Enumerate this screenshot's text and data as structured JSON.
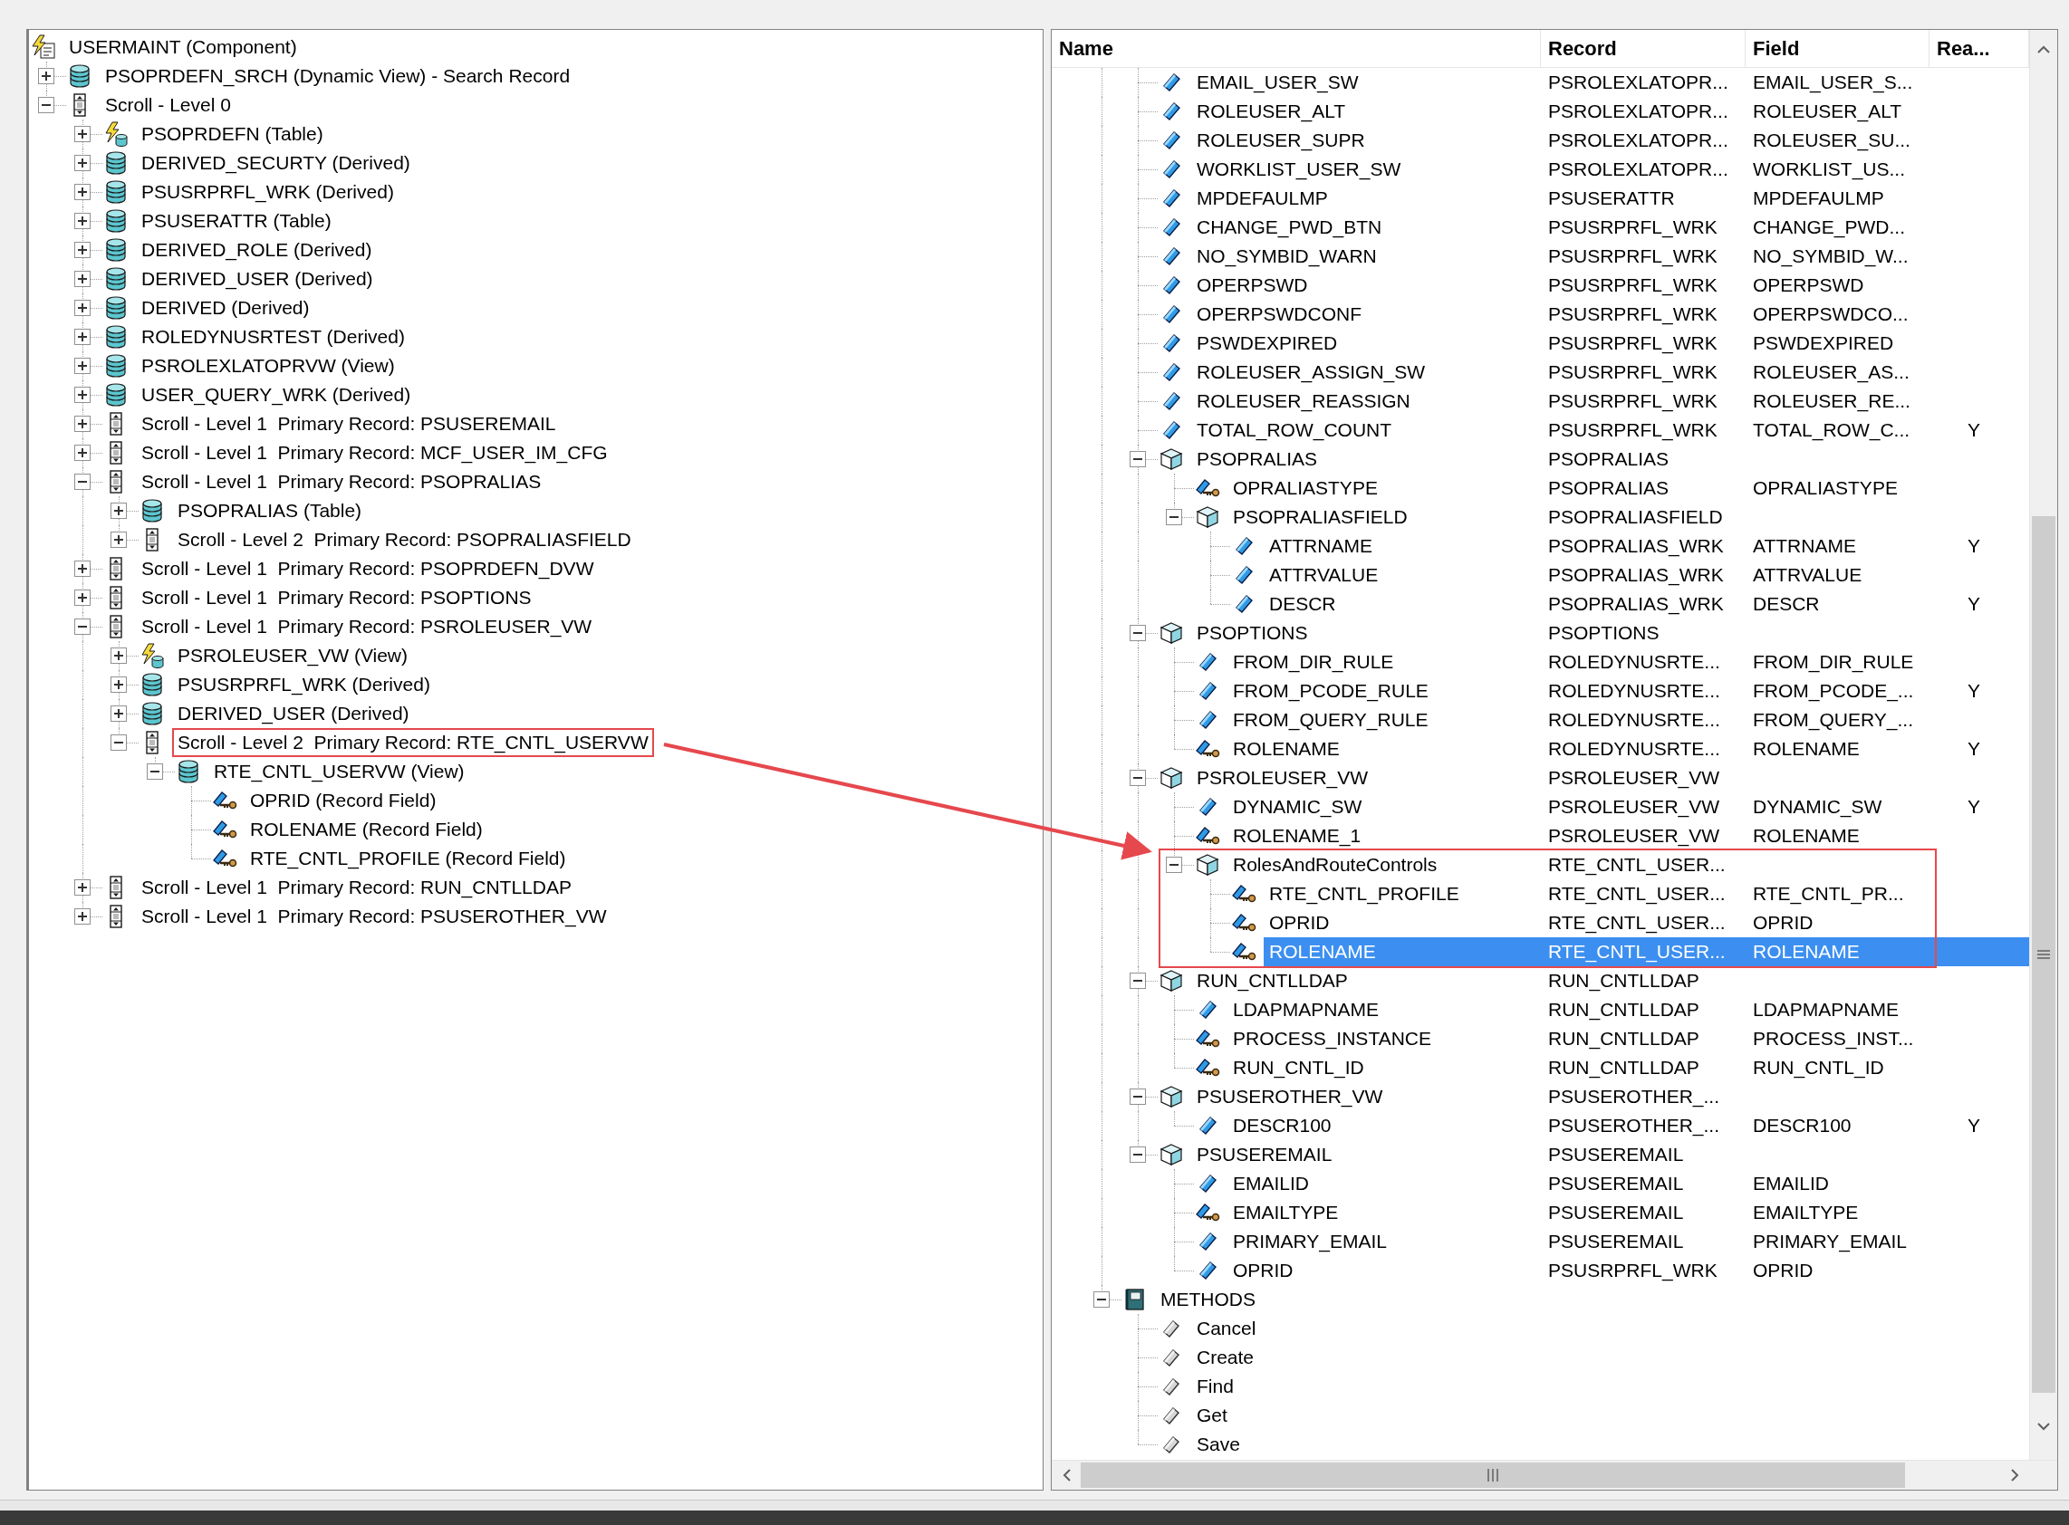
{
  "left_tree": {
    "nodes": [
      {
        "name": "USERMAINT (Component)",
        "kind": "component",
        "children": [
          {
            "name": "PSOPRDEFN_SRCH (Dynamic View) - Search Record",
            "kind": "record",
            "expanded": false
          },
          {
            "name": "Scroll - Level 0",
            "kind": "scroll",
            "expanded": true,
            "children": [
              {
                "name": "PSOPRDEFN (Table)",
                "kind": "record-event",
                "expanded": false
              },
              {
                "name": "DERIVED_SECURTY (Derived)",
                "kind": "record",
                "expanded": false
              },
              {
                "name": "PSUSRPRFL_WRK (Derived)",
                "kind": "record",
                "expanded": false
              },
              {
                "name": "PSUSERATTR (Table)",
                "kind": "record",
                "expanded": false
              },
              {
                "name": "DERIVED_ROLE (Derived)",
                "kind": "record",
                "expanded": false
              },
              {
                "name": "DERIVED_USER (Derived)",
                "kind": "record",
                "expanded": false
              },
              {
                "name": "DERIVED (Derived)",
                "kind": "record",
                "expanded": false
              },
              {
                "name": "ROLEDYNUSRTEST (Derived)",
                "kind": "record",
                "expanded": false
              },
              {
                "name": "PSROLEXLATOPRVW (View)",
                "kind": "record",
                "expanded": false
              },
              {
                "name": "USER_QUERY_WRK (Derived)",
                "kind": "record",
                "expanded": false
              },
              {
                "name": "Scroll - Level 1  Primary Record: PSUSEREMAIL",
                "kind": "scroll",
                "expanded": false
              },
              {
                "name": "Scroll - Level 1  Primary Record: MCF_USER_IM_CFG",
                "kind": "scroll",
                "expanded": false
              },
              {
                "name": "Scroll - Level 1  Primary Record: PSOPRALIAS",
                "kind": "scroll",
                "expanded": true,
                "children": [
                  {
                    "name": "PSOPRALIAS (Table)",
                    "kind": "record",
                    "expanded": false
                  },
                  {
                    "name": "Scroll - Level 2  Primary Record: PSOPRALIASFIELD",
                    "kind": "scroll",
                    "expanded": false
                  }
                ]
              },
              {
                "name": "Scroll - Level 1  Primary Record: PSOPRDEFN_DVW",
                "kind": "scroll",
                "expanded": false
              },
              {
                "name": "Scroll - Level 1  Primary Record: PSOPTIONS",
                "kind": "scroll",
                "expanded": false
              },
              {
                "name": "Scroll - Level 1  Primary Record: PSROLEUSER_VW",
                "kind": "scroll",
                "expanded": true,
                "children": [
                  {
                    "name": "PSROLEUSER_VW (View)",
                    "kind": "record-event",
                    "expanded": false
                  },
                  {
                    "name": "PSUSRPRFL_WRK (Derived)",
                    "kind": "record",
                    "expanded": false
                  },
                  {
                    "name": "DERIVED_USER (Derived)",
                    "kind": "record",
                    "expanded": false
                  },
                  {
                    "name": "Scroll - Level 2  Primary Record: RTE_CNTL_USERVW",
                    "kind": "scroll",
                    "expanded": true,
                    "highlighted": true,
                    "children": [
                      {
                        "name": "RTE_CNTL_USERVW (View)",
                        "kind": "record",
                        "expanded": true,
                        "children": [
                          {
                            "name": "OPRID (Record Field)",
                            "kind": "key-field"
                          },
                          {
                            "name": "ROLENAME (Record Field)",
                            "kind": "key-field"
                          },
                          {
                            "name": "RTE_CNTL_PROFILE (Record Field)",
                            "kind": "key-field"
                          }
                        ]
                      }
                    ]
                  }
                ]
              },
              {
                "name": "Scroll - Level 1  Primary Record: RUN_CNTLLDAP",
                "kind": "scroll",
                "expanded": false
              },
              {
                "name": "Scroll - Level 1  Primary Record: PSUSEROTHER_VW",
                "kind": "scroll",
                "expanded": false
              }
            ]
          }
        ]
      }
    ]
  },
  "right_tree": {
    "columns": [
      "Name",
      "Record",
      "Field",
      "Rea..."
    ],
    "nodes": [
      {
        "children": [
          {
            "name": "EMAIL_USER_SW",
            "kind": "field",
            "record": "PSROLEXLATOPR...",
            "field": "EMAIL_USER_S...",
            "selected": false
          },
          {
            "name": "ROLEUSER_ALT",
            "kind": "field",
            "record": "PSROLEXLATOPR...",
            "field": "ROLEUSER_ALT",
            "selected": false
          },
          {
            "name": "ROLEUSER_SUPR",
            "kind": "field",
            "record": "PSROLEXLATOPR...",
            "field": "ROLEUSER_SU...",
            "selected": false
          },
          {
            "name": "WORKLIST_USER_SW",
            "kind": "field",
            "record": "PSROLEXLATOPR...",
            "field": "WORKLIST_US...",
            "selected": false
          },
          {
            "name": "MPDEFAULMP",
            "kind": "field",
            "record": "PSUSERATTR",
            "field": "MPDEFAULMP",
            "selected": false
          },
          {
            "name": "CHANGE_PWD_BTN",
            "kind": "field",
            "record": "PSUSRPRFL_WRK",
            "field": "CHANGE_PWD...",
            "selected": false
          },
          {
            "name": "NO_SYMBID_WARN",
            "kind": "field",
            "record": "PSUSRPRFL_WRK",
            "field": "NO_SYMBID_W...",
            "selected": false
          },
          {
            "name": "OPERPSWD",
            "kind": "field",
            "record": "PSUSRPRFL_WRK",
            "field": "OPERPSWD",
            "selected": false
          },
          {
            "name": "OPERPSWDCONF",
            "kind": "field",
            "record": "PSUSRPRFL_WRK",
            "field": "OPERPSWDCO...",
            "selected": false
          },
          {
            "name": "PSWDEXPIRED",
            "kind": "field",
            "record": "PSUSRPRFL_WRK",
            "field": "PSWDEXPIRED",
            "selected": false
          },
          {
            "name": "ROLEUSER_ASSIGN_SW",
            "kind": "field",
            "record": "PSUSRPRFL_WRK",
            "field": "ROLEUSER_AS...",
            "selected": false
          },
          {
            "name": "ROLEUSER_REASSIGN",
            "kind": "field",
            "record": "PSUSRPRFL_WRK",
            "field": "ROLEUSER_RE...",
            "selected": false
          },
          {
            "name": "TOTAL_ROW_COUNT",
            "kind": "field",
            "record": "PSUSRPRFL_WRK",
            "field": "TOTAL_ROW_C...",
            "read": "Y",
            "selected": false
          },
          {
            "name": "PSOPRALIAS",
            "kind": "group",
            "record": "PSOPRALIAS",
            "expanded": true,
            "selected": false,
            "children": [
              {
                "name": "OPRALIASTYPE",
                "kind": "key-field",
                "record": "PSOPRALIAS",
                "field": "OPRALIASTYPE",
                "selected": false
              },
              {
                "name": "PSOPRALIASFIELD",
                "kind": "group",
                "record": "PSOPRALIASFIELD",
                "expanded": true,
                "selected": false,
                "children": [
                  {
                    "name": "ATTRNAME",
                    "kind": "field",
                    "record": "PSOPRALIAS_WRK",
                    "field": "ATTRNAME",
                    "read": "Y",
                    "selected": false
                  },
                  {
                    "name": "ATTRVALUE",
                    "kind": "field",
                    "record": "PSOPRALIAS_WRK",
                    "field": "ATTRVALUE",
                    "selected": false
                  },
                  {
                    "name": "DESCR",
                    "kind": "field",
                    "record": "PSOPRALIAS_WRK",
                    "field": "DESCR",
                    "read": "Y",
                    "selected": false
                  }
                ]
              }
            ]
          },
          {
            "name": "PSOPTIONS",
            "kind": "group",
            "record": "PSOPTIONS",
            "expanded": true,
            "selected": false,
            "children": [
              {
                "name": "FROM_DIR_RULE",
                "kind": "field",
                "record": "ROLEDYNUSRTE...",
                "field": "FROM_DIR_RULE",
                "selected": false
              },
              {
                "name": "FROM_PCODE_RULE",
                "kind": "field",
                "record": "ROLEDYNUSRTE...",
                "field": "FROM_PCODE_...",
                "read": "Y",
                "selected": false
              },
              {
                "name": "FROM_QUERY_RULE",
                "kind": "field",
                "record": "ROLEDYNUSRTE...",
                "field": "FROM_QUERY_...",
                "selected": false
              },
              {
                "name": "ROLENAME",
                "kind": "key-field",
                "record": "ROLEDYNUSRTE...",
                "field": "ROLENAME",
                "read": "Y",
                "selected": false
              }
            ]
          },
          {
            "name": "PSROLEUSER_VW",
            "kind": "group",
            "record": "PSROLEUSER_VW",
            "expanded": true,
            "selected": false,
            "children": [
              {
                "name": "DYNAMIC_SW",
                "kind": "field",
                "record": "PSROLEUSER_VW",
                "field": "DYNAMIC_SW",
                "read": "Y",
                "selected": false
              },
              {
                "name": "ROLENAME_1",
                "kind": "key-field",
                "record": "PSROLEUSER_VW",
                "field": "ROLENAME",
                "selected": false
              },
              {
                "name": "RolesAndRouteControls",
                "kind": "group",
                "record": "RTE_CNTL_USER...",
                "expanded": true,
                "highlighted": true,
                "selected": false,
                "children": [
                  {
                    "name": "RTE_CNTL_PROFILE",
                    "kind": "key-field",
                    "record": "RTE_CNTL_USER...",
                    "field": "RTE_CNTL_PR...",
                    "selected": false
                  },
                  {
                    "name": "OPRID",
                    "kind": "key-field",
                    "record": "RTE_CNTL_USER...",
                    "field": "OPRID",
                    "selected": false
                  },
                  {
                    "name": "ROLENAME",
                    "kind": "key-field",
                    "record": "RTE_CNTL_USER...",
                    "field": "ROLENAME",
                    "selected": true
                  }
                ]
              }
            ]
          },
          {
            "name": "RUN_CNTLLDAP",
            "kind": "group",
            "record": "RUN_CNTLLDAP",
            "expanded": true,
            "selected": false,
            "children": [
              {
                "name": "LDAPMAPNAME",
                "kind": "field",
                "record": "RUN_CNTLLDAP",
                "field": "LDAPMAPNAME",
                "selected": false
              },
              {
                "name": "PROCESS_INSTANCE",
                "kind": "key-field",
                "record": "RUN_CNTLLDAP",
                "field": "PROCESS_INST...",
                "selected": false
              },
              {
                "name": "RUN_CNTL_ID",
                "kind": "key-field",
                "record": "RUN_CNTLLDAP",
                "field": "RUN_CNTL_ID",
                "selected": false
              }
            ]
          },
          {
            "name": "PSUSEROTHER_VW",
            "kind": "group",
            "record": "PSUSEROTHER_...",
            "expanded": true,
            "selected": false,
            "children": [
              {
                "name": "DESCR100",
                "kind": "field",
                "record": "PSUSEROTHER_...",
                "field": "DESCR100",
                "read": "Y",
                "selected": false
              }
            ]
          },
          {
            "name": "PSUSEREMAIL",
            "kind": "group",
            "record": "PSUSEREMAIL",
            "expanded": true,
            "selected": false,
            "children": [
              {
                "name": "EMAILID",
                "kind": "field",
                "record": "PSUSEREMAIL",
                "field": "EMAILID",
                "selected": false
              },
              {
                "name": "EMAILTYPE",
                "kind": "key-field",
                "record": "PSUSEREMAIL",
                "field": "EMAILTYPE",
                "selected": false
              },
              {
                "name": "PRIMARY_EMAIL",
                "kind": "field",
                "record": "PSUSEREMAIL",
                "field": "PRIMARY_EMAIL",
                "selected": false
              },
              {
                "name": "OPRID",
                "kind": "field",
                "record": "PSUSRPRFL_WRK",
                "field": "OPRID",
                "selected": false
              }
            ]
          }
        ]
      },
      {
        "name": "METHODS",
        "kind": "methods",
        "expanded": true,
        "selected": false,
        "children": [
          {
            "name": "Cancel",
            "kind": "method",
            "selected": false
          },
          {
            "name": "Create",
            "kind": "method",
            "selected": false
          },
          {
            "name": "Find",
            "kind": "method",
            "selected": false
          },
          {
            "name": "Get",
            "kind": "method",
            "selected": false
          },
          {
            "name": "Save",
            "kind": "method",
            "selected": false
          }
        ]
      }
    ]
  }
}
